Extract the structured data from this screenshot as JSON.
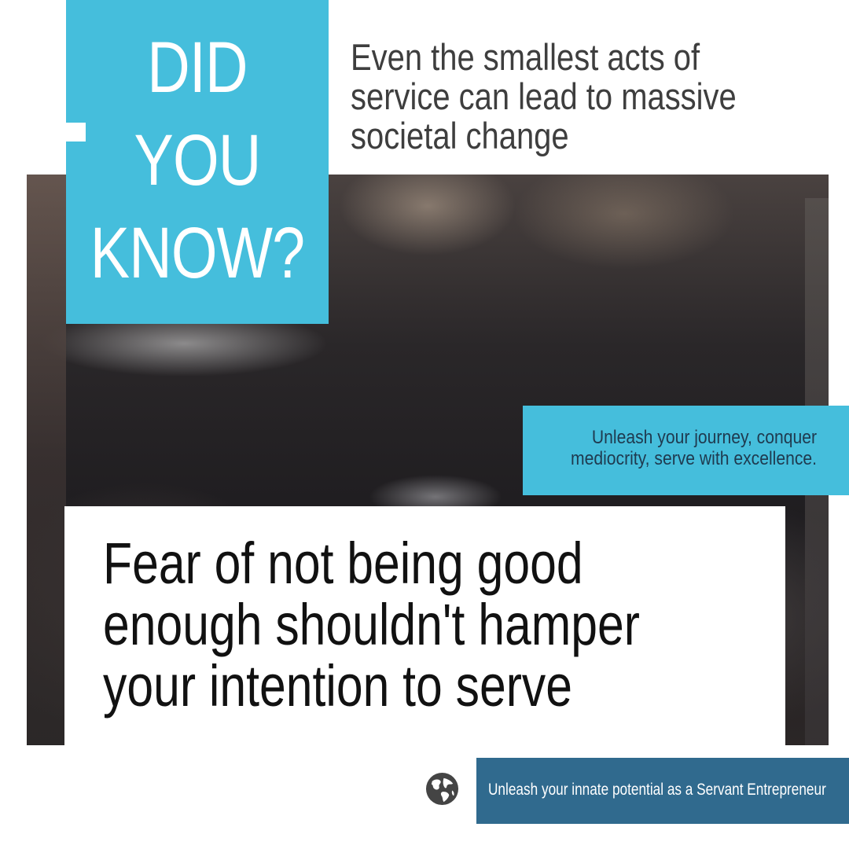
{
  "headline": {
    "lines": [
      "DID",
      "YOU",
      "KNOW?"
    ]
  },
  "intro": {
    "text": "Even the smallest acts of service can lead to massive societal change"
  },
  "tagline": {
    "text": "Unleash your journey, conquer mediocrity, serve with excellence."
  },
  "quote": {
    "text": "Fear of not being good enough shouldn't hamper your intention to serve"
  },
  "footer": {
    "icon": "globe-icon",
    "text": "Unleash your innate potential as a Servant Entrepreneur"
  },
  "colors": {
    "accent_blue": "#45bedc",
    "footer_blue": "#306a8e",
    "dark_text": "#111111"
  }
}
